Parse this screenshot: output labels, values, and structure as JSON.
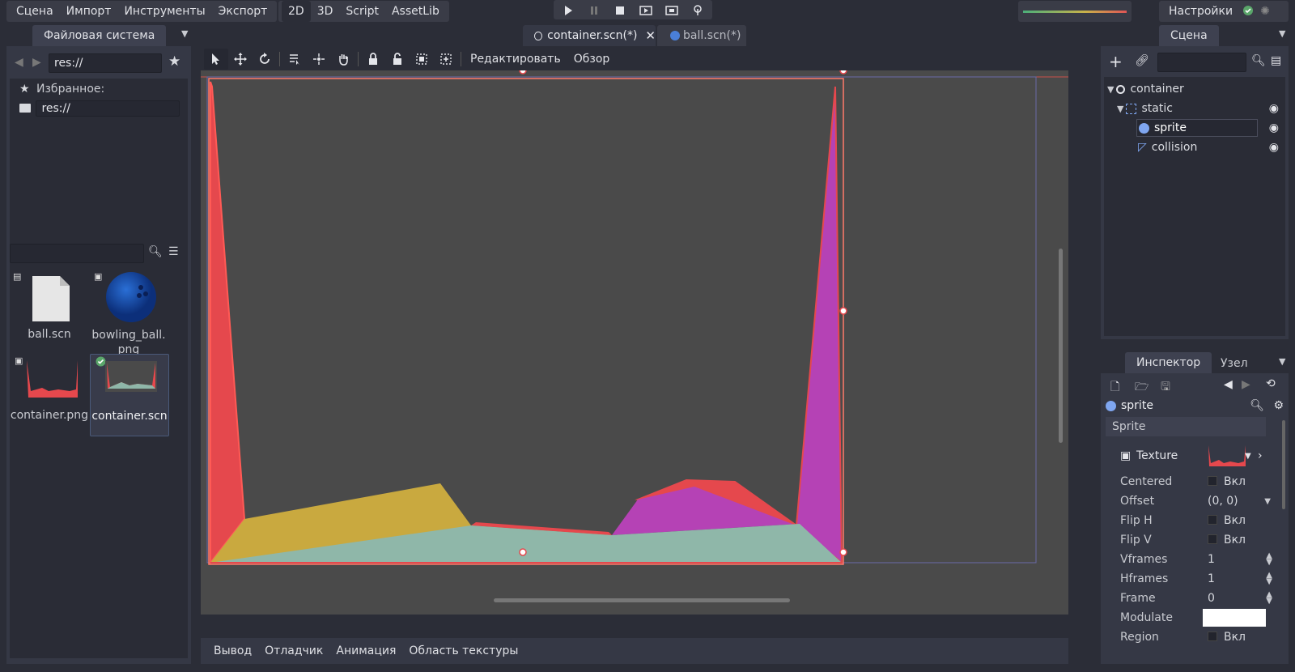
{
  "menu": {
    "items": [
      "Сцена",
      "Импорт",
      "Инструменты",
      "Экспорт"
    ]
  },
  "modes": {
    "items": [
      "2D",
      "3D",
      "Script",
      "AssetLib"
    ],
    "active": "2D"
  },
  "play_controls": [
    "play-icon",
    "pause-icon",
    "stop-icon",
    "play-scene-icon",
    "play-custom-scene-icon",
    "remote-debug-icon"
  ],
  "settings": {
    "label": "Настройки"
  },
  "filesystem": {
    "tab": "Файловая система",
    "path": "res://",
    "favorites_label": "Избранное:",
    "tree_root": "res://",
    "search_placeholder": "",
    "files": [
      {
        "name": "ball.scn",
        "type": "scene"
      },
      {
        "name": "bowling_ball.png",
        "type": "image"
      },
      {
        "name": "container.png",
        "type": "image"
      },
      {
        "name": "container.scn",
        "type": "scene",
        "selected": true
      }
    ]
  },
  "editor_tabs": [
    {
      "label": "container.scn(*)",
      "active": true
    },
    {
      "label": "ball.scn(*)",
      "active": false
    }
  ],
  "toolbar2d": {
    "edit_menu": "Редактировать",
    "view_menu": "Обзор"
  },
  "bottom_tabs": [
    "Вывод",
    "Отладчик",
    "Анимация",
    "Область текстуры"
  ],
  "scene_dock": {
    "tab": "Сцена",
    "nodes": [
      {
        "name": "container",
        "depth": 0
      },
      {
        "name": "static",
        "depth": 1
      },
      {
        "name": "sprite",
        "depth": 2,
        "selected": true
      },
      {
        "name": "collision",
        "depth": 2
      }
    ]
  },
  "inspector": {
    "tabs": [
      "Инспектор",
      "Узел"
    ],
    "node_name": "sprite",
    "section": "Sprite",
    "texture_label": "Texture",
    "props": [
      {
        "label": "Centered",
        "value": "Вкл",
        "kind": "check"
      },
      {
        "label": "Offset",
        "value": "(0, 0)",
        "kind": "dropdown"
      },
      {
        "label": "Flip H",
        "value": "Вкл",
        "kind": "check"
      },
      {
        "label": "Flip V",
        "value": "Вкл",
        "kind": "check"
      },
      {
        "label": "Vframes",
        "value": "1",
        "kind": "spin"
      },
      {
        "label": "Hframes",
        "value": "1",
        "kind": "spin"
      },
      {
        "label": "Frame",
        "value": "0",
        "kind": "spin"
      },
      {
        "label": "Modulate",
        "value": "",
        "kind": "color"
      },
      {
        "label": "Region",
        "value": "Вкл",
        "kind": "check"
      }
    ]
  },
  "colors": {
    "accent_red": "#e5484d",
    "polygon_yellow": "#c9a93f",
    "polygon_purple": "#b542b5",
    "polygon_teal": "#8fb7a9",
    "viewport_bg": "#4a4a4a"
  }
}
